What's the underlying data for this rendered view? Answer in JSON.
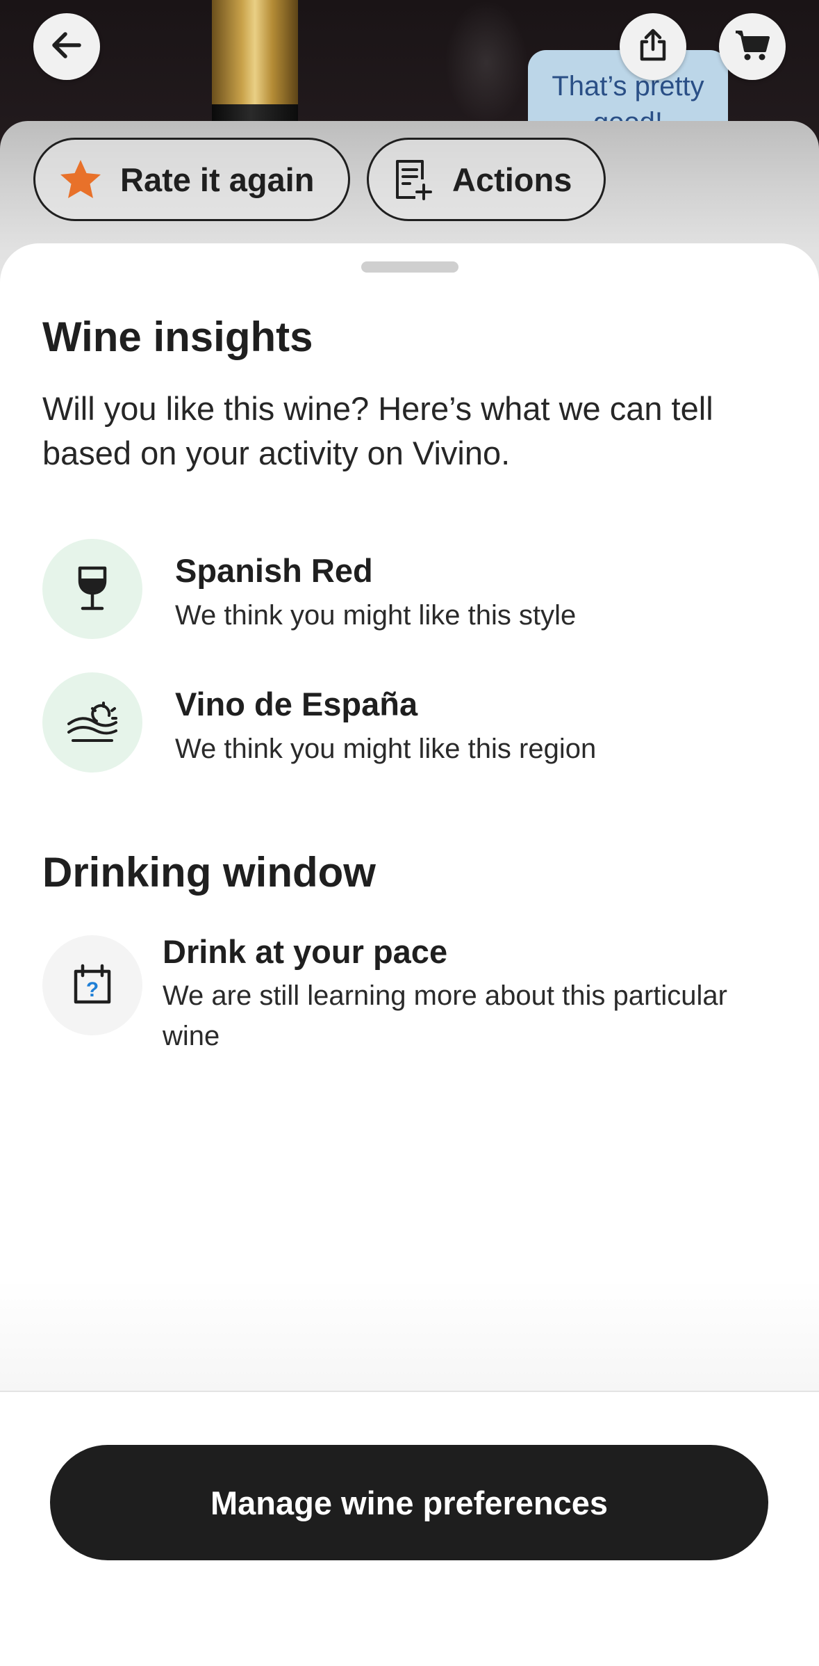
{
  "header": {
    "back_icon": "arrow-left-icon",
    "share_icon": "share-icon",
    "cart_icon": "cart-icon",
    "bubble_text": "That’s pretty good!"
  },
  "actions": {
    "rate_label": "Rate it again",
    "rate_icon": "star-icon",
    "rate_icon_color": "#e8712a",
    "actions_label": "Actions",
    "actions_icon": "note-add-icon"
  },
  "insights": {
    "title": "Wine insights",
    "intro": "Will you like this wine? Here’s what we can tell based on your activity on Vivino.",
    "items": [
      {
        "icon": "wine-glass-icon",
        "title": "Spanish Red",
        "subtitle": "We think you might like this style"
      },
      {
        "icon": "region-landscape-icon",
        "title": "Vino de España",
        "subtitle": "We think you might like this region"
      }
    ],
    "accent_bg": "#e6f4ea"
  },
  "drinking_window": {
    "title": "Drinking window",
    "icon": "calendar-question-icon",
    "item_title": "Drink at your pace",
    "item_subtitle": "We are still learning more about this particular wine"
  },
  "footer": {
    "button_label": "Manage wine preferences",
    "button_color": "#1e1e1e"
  }
}
